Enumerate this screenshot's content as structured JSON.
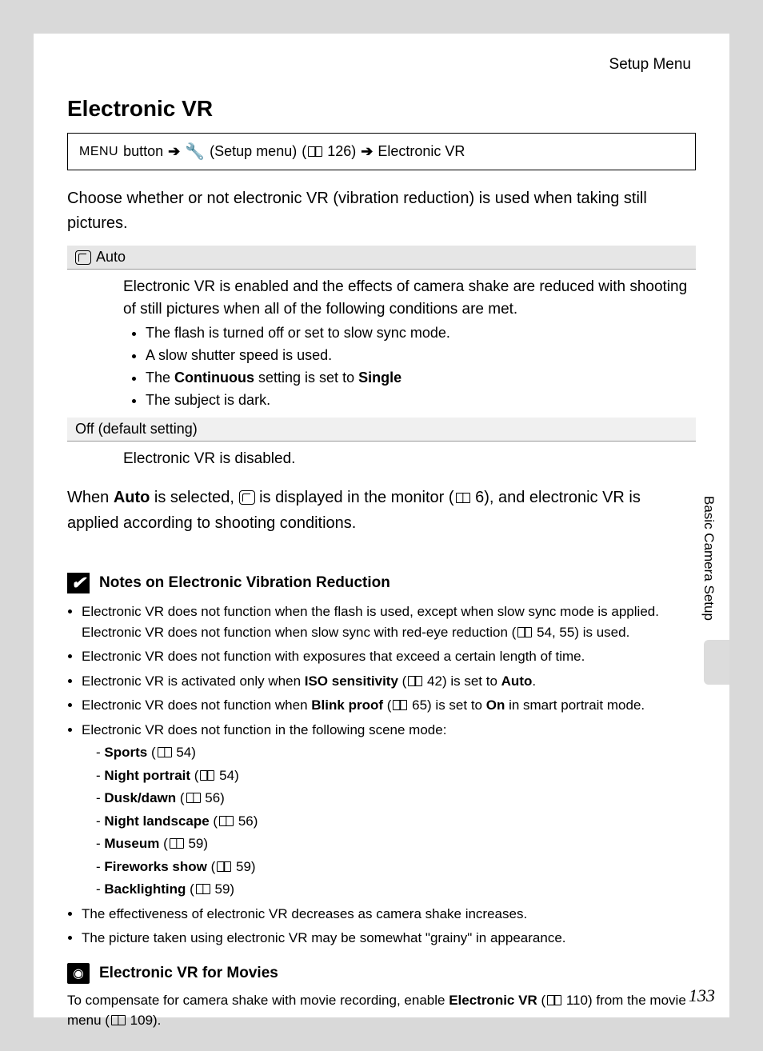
{
  "header": {
    "section_label": "Setup Menu"
  },
  "title": "Electronic VR",
  "breadcrumb": {
    "menu_label": "MENU",
    "button_word": "button",
    "setup_label": "(Setup menu)",
    "setup_ref": "126)",
    "target": "Electronic VR"
  },
  "intro": "Choose whether or not electronic VR (vibration reduction) is used when taking still pictures.",
  "options": {
    "auto": {
      "label": "Auto",
      "desc": "Electronic VR is enabled and the effects of camera shake are reduced with shooting of still pictures when all of the following conditions are met.",
      "bullets": {
        "b1": "The flash is turned off or set to slow sync mode.",
        "b2": "A slow shutter speed is used.",
        "b3_pre": "The ",
        "b3_bold1": "Continuous",
        "b3_mid": " setting is set to ",
        "b3_bold2": "Single",
        "b4": "The subject is dark."
      }
    },
    "off": {
      "label": "Off (default setting)",
      "desc": "Electronic VR is disabled."
    }
  },
  "after_table": {
    "pre": "When ",
    "bold": "Auto",
    "mid": " is selected, ",
    "post1": " is displayed in the monitor (",
    "ref": "6), and electronic VR is applied according to shooting conditions."
  },
  "notes": {
    "heading": "Notes on Electronic Vibration Reduction",
    "n1a": "Electronic VR does not function when the flash is used, except when slow sync mode is applied. Electronic VR does not function when slow sync with red-eye reduction (",
    "n1b": "54, 55) is used.",
    "n2": "Electronic VR does not function with exposures that exceed a certain length of time.",
    "n3_pre": "Electronic VR is activated only when ",
    "n3_b1": "ISO sensitivity",
    "n3_mid": " (",
    "n3_ref": "42) is set to ",
    "n3_b2": "Auto",
    "n4_pre": "Electronic VR does not function when ",
    "n4_b1": "Blink proof",
    "n4_mid": " (",
    "n4_ref": "65) is set to ",
    "n4_b2": "On",
    "n4_post": " in smart portrait mode.",
    "n5": "Electronic VR does not function in the following scene mode:",
    "scenes": [
      {
        "name": "Sports",
        "ref": "54)"
      },
      {
        "name": "Night portrait",
        "ref": "54)"
      },
      {
        "name": "Dusk/dawn",
        "ref": "56)"
      },
      {
        "name": "Night landscape",
        "ref": "56)"
      },
      {
        "name": "Museum",
        "ref": "59)"
      },
      {
        "name": "Fireworks show",
        "ref": "59)"
      },
      {
        "name": "Backlighting",
        "ref": "59)"
      }
    ],
    "n6": "The effectiveness of electronic VR decreases as camera shake increases.",
    "n7": "The picture taken using electronic VR may be somewhat \"grainy\" in appearance."
  },
  "movies": {
    "heading": "Electronic VR for Movies",
    "pre": "To compensate for camera shake with movie recording, enable ",
    "bold": "Electronic VR",
    "mid": " (",
    "ref1": "110) from the movie menu (",
    "ref2": "109)."
  },
  "side_label": "Basic Camera Setup",
  "page_number": "133"
}
